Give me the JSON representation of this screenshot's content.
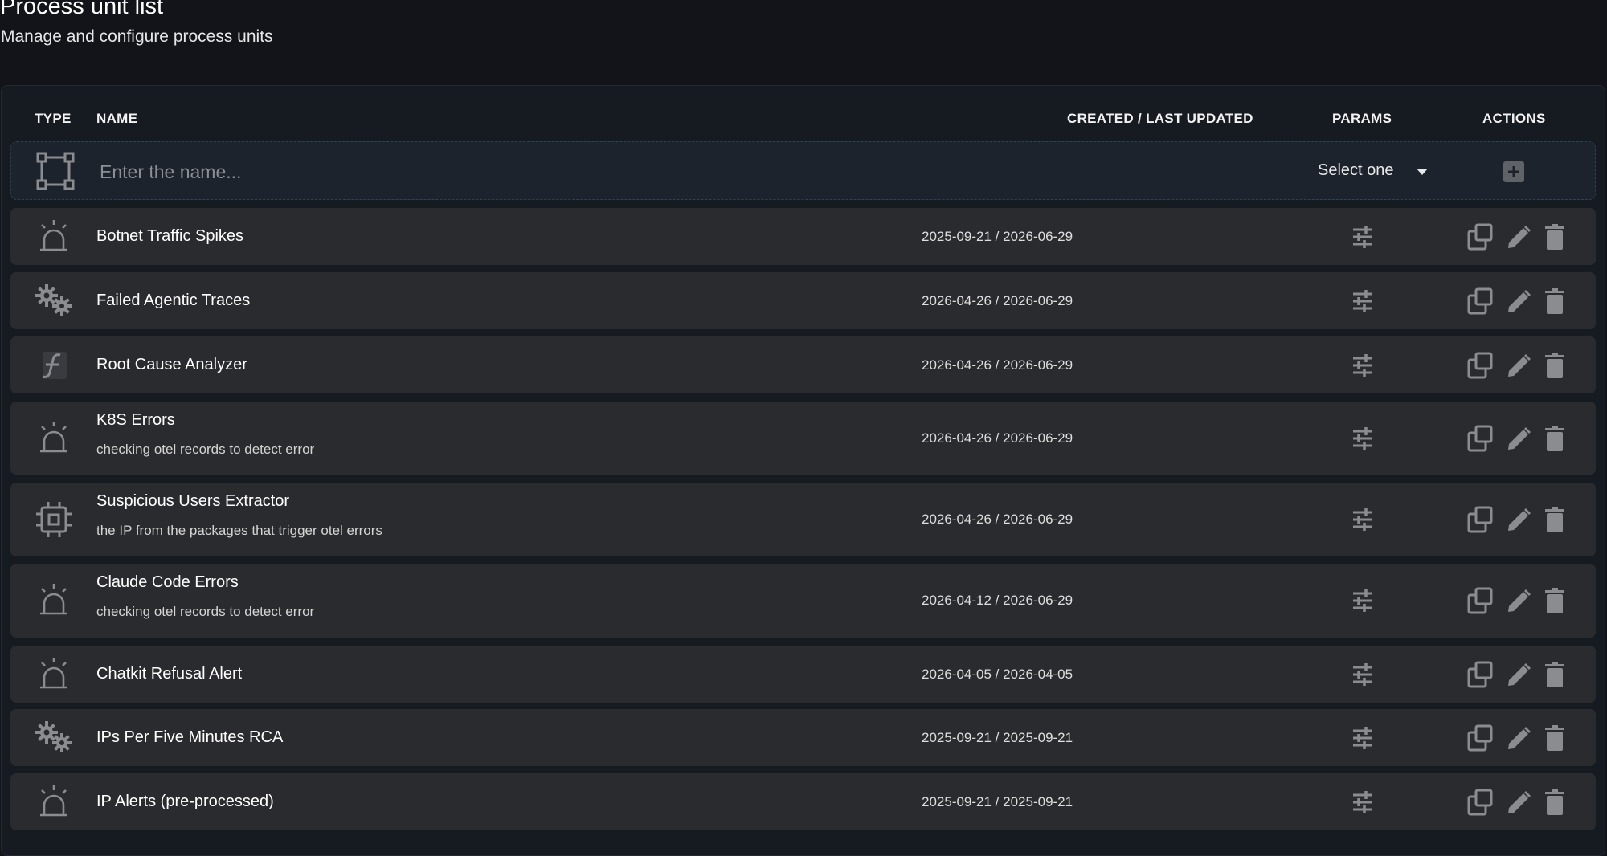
{
  "page": {
    "title": "Process unit list",
    "subtitle": "Manage and configure process units"
  },
  "table": {
    "headers": {
      "type": "TYPE",
      "name": "NAME",
      "created": "CREATED / LAST UPDATED",
      "params": "PARAMS",
      "actions": "ACTIONS"
    },
    "new_row": {
      "type_icon": "frame-icon",
      "name_placeholder": "Enter the name...",
      "name_value": "",
      "select_value": "Select one",
      "add_icon": "plus-box-icon"
    },
    "rows": [
      {
        "type_icon": "alarm-icon",
        "name": "Botnet Traffic Spikes",
        "description": "",
        "dates": "2025-09-21 / 2026-06-29"
      },
      {
        "type_icon": "gears-icon",
        "name": "Failed Agentic Traces",
        "description": "",
        "dates": "2026-04-26 / 2026-06-29"
      },
      {
        "type_icon": "function-icon",
        "name": "Root Cause Analyzer",
        "description": "",
        "dates": "2026-04-26 / 2026-06-29"
      },
      {
        "type_icon": "alarm-icon",
        "name": "K8S Errors",
        "description": "checking otel records to detect error",
        "dates": "2026-04-26 / 2026-06-29"
      },
      {
        "type_icon": "chip-icon",
        "name": "Suspicious Users Extractor",
        "description": "the IP from the packages that trigger otel errors",
        "dates": "2026-04-26 / 2026-06-29"
      },
      {
        "type_icon": "alarm-icon",
        "name": "Claude Code Errors",
        "description": "checking otel records to detect error",
        "dates": "2026-04-12 / 2026-06-29"
      },
      {
        "type_icon": "alarm-icon",
        "name": "Chatkit Refusal Alert",
        "description": "",
        "dates": "2026-04-05 / 2026-04-05"
      },
      {
        "type_icon": "gears-icon",
        "name": "IPs Per Five Minutes RCA",
        "description": "",
        "dates": "2025-09-21 / 2025-09-21"
      },
      {
        "type_icon": "alarm-icon",
        "name": "IP Alerts (pre-processed)",
        "description": "",
        "dates": "2025-09-21 / 2025-09-21"
      }
    ],
    "row_actions": [
      "params-sliders-icon",
      "duplicate-icon",
      "edit-pencil-icon",
      "delete-trash-icon"
    ]
  },
  "colors": {
    "background": "#12141a",
    "panel": "#161a21",
    "row": "#2a2b2f",
    "icon": "#8a8c90"
  }
}
